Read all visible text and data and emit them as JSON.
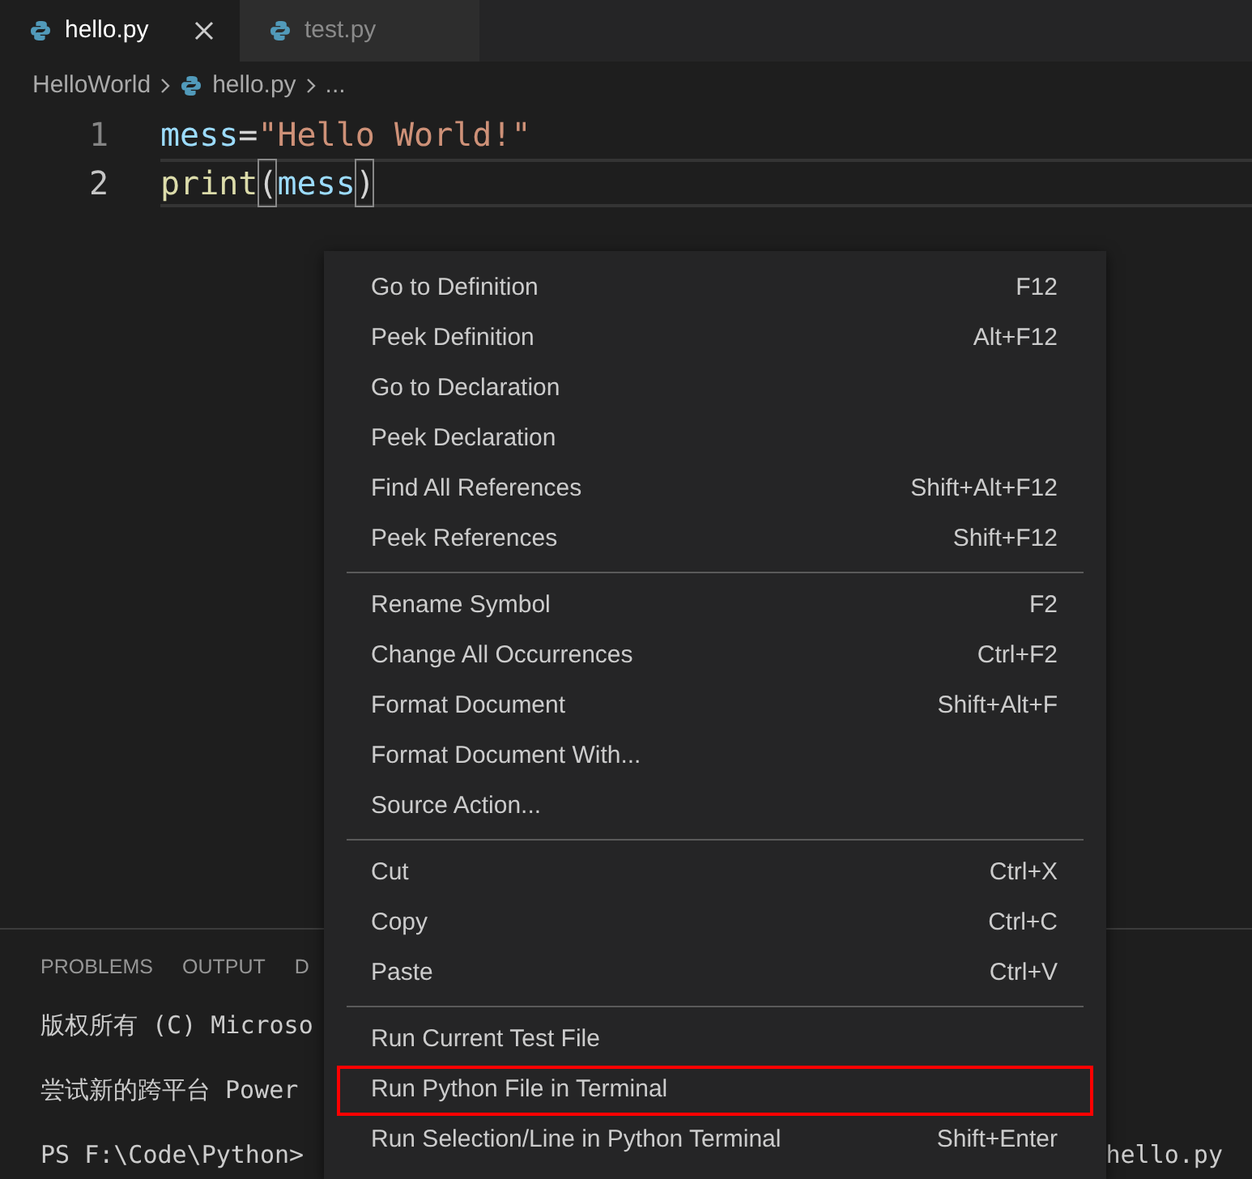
{
  "tabs": [
    {
      "label": "hello.py",
      "selected": true,
      "closable": true
    },
    {
      "label": "test.py",
      "selected": false,
      "closable": false
    }
  ],
  "breadcrumb": [
    "HelloWorld",
    "hello.py",
    "..."
  ],
  "editor": {
    "lines": [
      {
        "number": "1",
        "current": false,
        "tokens": [
          {
            "kind": "variable",
            "text": "mess"
          },
          {
            "kind": "operator",
            "text": "="
          },
          {
            "kind": "string",
            "text": "\"Hello World!\""
          }
        ]
      },
      {
        "number": "2",
        "current": true,
        "tokens": [
          {
            "kind": "function",
            "text": "print"
          },
          {
            "kind": "bracket-match",
            "text": "("
          },
          {
            "kind": "variable",
            "text": "mess"
          },
          {
            "kind": "bracket-match",
            "text": ")"
          }
        ]
      }
    ]
  },
  "panel": {
    "tabs": [
      "PROBLEMS",
      "OUTPUT",
      "D"
    ],
    "terminal_lines": [
      "版权所有 (C) Microso",
      "尝试新的跨平台 Power",
      "PS F:\\Code\\Python>"
    ],
    "terminal_right_text": "hello.py"
  },
  "context_menu": {
    "groups": [
      [
        {
          "label": "Go to Definition",
          "shortcut": "F12",
          "highlighted": false
        },
        {
          "label": "Peek Definition",
          "shortcut": "Alt+F12",
          "highlighted": false
        },
        {
          "label": "Go to Declaration",
          "highlighted": false
        },
        {
          "label": "Peek Declaration",
          "highlighted": false
        },
        {
          "label": "Find All References",
          "shortcut": "Shift+Alt+F12",
          "highlighted": false
        },
        {
          "label": "Peek References",
          "shortcut": "Shift+F12",
          "highlighted": false
        }
      ],
      [
        {
          "label": "Rename Symbol",
          "shortcut": "F2",
          "highlighted": false
        },
        {
          "label": "Change All Occurrences",
          "shortcut": "Ctrl+F2",
          "highlighted": false
        },
        {
          "label": "Format Document",
          "shortcut": "Shift+Alt+F",
          "highlighted": false
        },
        {
          "label": "Format Document With...",
          "highlighted": false
        },
        {
          "label": "Source Action...",
          "highlighted": false
        }
      ],
      [
        {
          "label": "Cut",
          "shortcut": "Ctrl+X",
          "highlighted": false
        },
        {
          "label": "Copy",
          "shortcut": "Ctrl+C",
          "highlighted": false
        },
        {
          "label": "Paste",
          "shortcut": "Ctrl+V",
          "highlighted": false
        }
      ],
      [
        {
          "label": "Run Current Test File",
          "highlighted": false
        },
        {
          "label": "Run Python File in Terminal",
          "highlighted": true
        },
        {
          "label": "Run Selection/Line in Python Terminal",
          "shortcut": "Shift+Enter",
          "highlighted": false
        }
      ]
    ]
  }
}
